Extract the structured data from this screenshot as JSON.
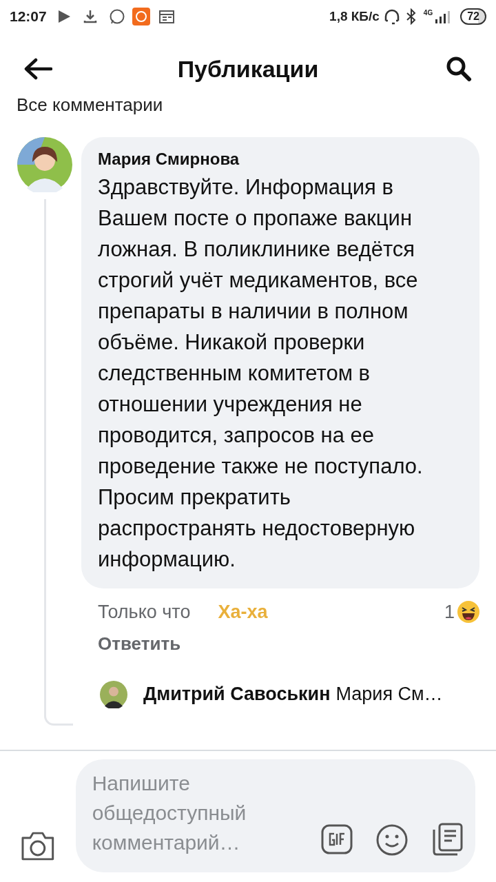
{
  "status_bar": {
    "time": "12:07",
    "speed": "1,8 КБ/с",
    "network": "4G",
    "battery": "72"
  },
  "header": {
    "title": "Публикации"
  },
  "section_label": "Все комментарии",
  "comment": {
    "author": "Мария Смирнова",
    "text": "Здравствуйте. Информация в Вашем посте о пропаже вакцин ложная. В поликлинике ведётся строгий учёт медикаментов, все препараты в наличии в полном объёме. Никакой проверки следственным комитетом в отношении учреждения не проводится, запросов на ее проведение также не поступало. Просим прекратить распространять недостоверную информацию.",
    "time": "Только что",
    "reaction": "Ха-ха",
    "reaction_selected": true,
    "reply": "Ответить",
    "reaction_count": "1"
  },
  "reply_preview": {
    "author": "Дмитрий Савоськин",
    "text": "Мария См…"
  },
  "composer": {
    "placeholder": "Напишите общедоступный комментарий…"
  }
}
